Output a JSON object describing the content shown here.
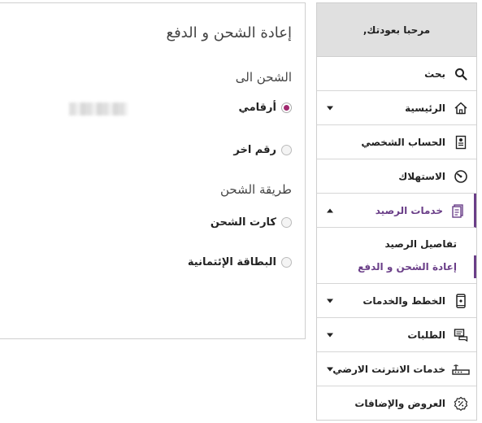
{
  "sidebar": {
    "welcome": "مرحبا بعودتك,",
    "items": [
      {
        "label": "بحث",
        "icon": "search-icon"
      },
      {
        "label": "الرئيسية",
        "icon": "home-icon"
      },
      {
        "label": "الحساب الشخصي",
        "icon": "profile-document-icon"
      },
      {
        "label": "الاستهلاك",
        "icon": "gauge-icon"
      },
      {
        "label": "خدمات الرصيد",
        "icon": "balance-document-icon"
      },
      {
        "label": "الخطط والخدمات",
        "icon": "mobile-plan-icon"
      },
      {
        "label": "الطلبات",
        "icon": "requests-chat-icon"
      },
      {
        "label": "خدمات الانترنت الارضي",
        "icon": "router-icon"
      },
      {
        "label": "العروض والإضافات",
        "icon": "offers-badge-icon"
      }
    ],
    "sub_items": [
      {
        "label": "تفاصيل الرصيد"
      },
      {
        "label": "إعادة الشحن و الدفع"
      }
    ],
    "accent_color": "#6a3e88"
  },
  "panel": {
    "title": "إعادة الشحن و الدفع",
    "recharge_to_label": "الشحن الى",
    "recharge_to_options": [
      {
        "label": "أرقامي",
        "checked": true
      },
      {
        "label": "رقم اخر",
        "checked": false
      }
    ],
    "method_label": "طريقة الشحن",
    "method_options": [
      {
        "label": "كارت الشحن",
        "checked": false
      },
      {
        "label": "البطاقة الإئتمانية",
        "checked": false
      }
    ],
    "radio_accent": "#a0286e"
  }
}
